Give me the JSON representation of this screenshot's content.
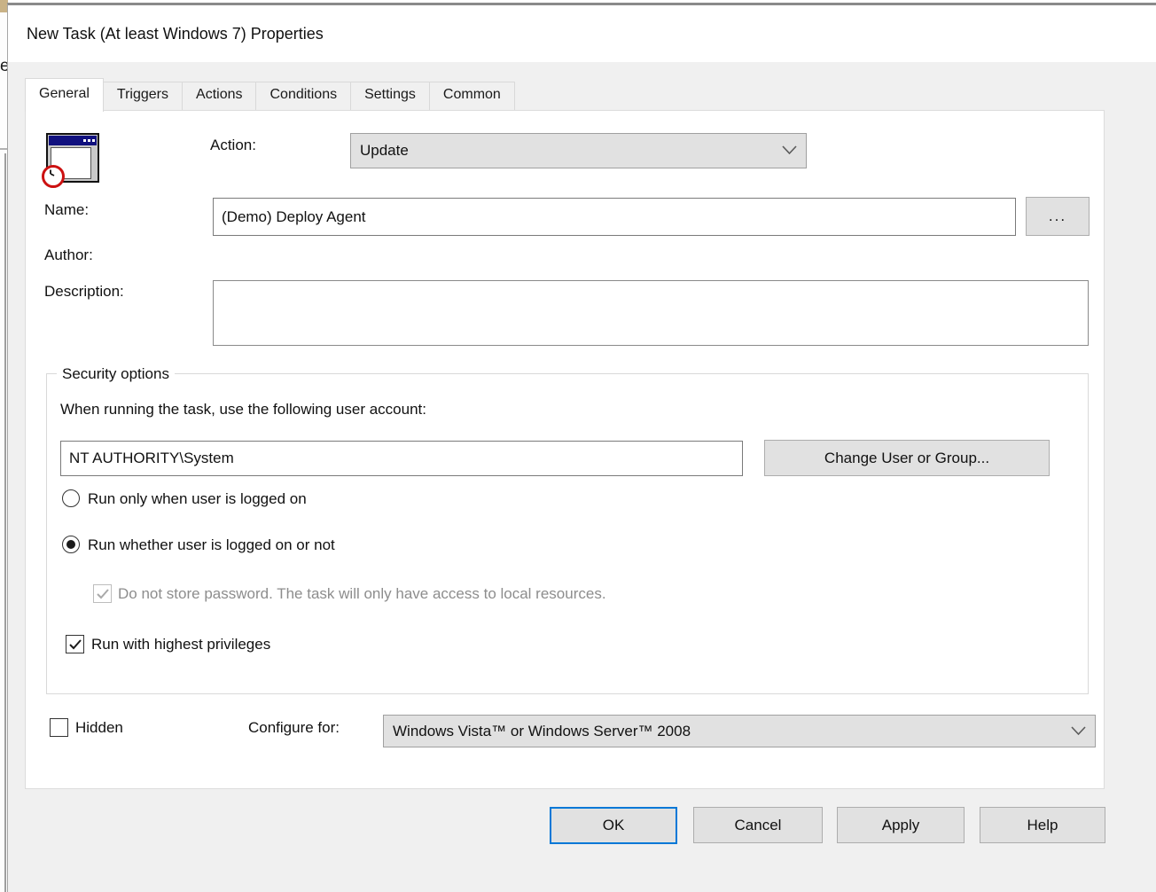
{
  "background": {
    "fragment_text": "e"
  },
  "window": {
    "title": "New Task (At least Windows 7) Properties"
  },
  "tabs": {
    "items": [
      "General",
      "Triggers",
      "Actions",
      "Conditions",
      "Settings",
      "Common"
    ],
    "active": "General"
  },
  "general": {
    "action_label": "Action:",
    "action_value": "Update",
    "name_label": "Name:",
    "name_value": "(Demo) Deploy Agent",
    "browse_label": "...",
    "author_label": "Author:",
    "description_label": "Description:",
    "security": {
      "legend": "Security options",
      "account_prompt": "When running the task, use the following user account:",
      "account_value": "NT AUTHORITY\\System",
      "change_user_label": "Change User or Group...",
      "radio_logged_on_label": "Run only when user is logged on",
      "radio_whether_label": "Run whether user is logged on or not",
      "no_password_label": "Do not store password. The task will only have access to local resources.",
      "privileges_label": "Run with highest privileges"
    },
    "hidden_label": "Hidden",
    "configure_label": "Configure for:",
    "configure_value": "Windows Vista™ or Windows Server™ 2008"
  },
  "state": {
    "run_only_when_logged_on": false,
    "run_whether_logged_on": true,
    "do_not_store_password_checked": true,
    "do_not_store_password_disabled": true,
    "run_with_highest_privileges": true,
    "hidden": false
  },
  "footer": {
    "ok_label": "OK",
    "cancel_label": "Cancel",
    "apply_label": "Apply",
    "help_label": "Help"
  },
  "colors": {
    "accent": "#0078d7",
    "dialog_bg": "#f0f0f0",
    "control_bg": "#e1e1e1",
    "control_border": "#adadad",
    "input_border": "#7a7a7a",
    "disabled_text": "#8d8d8d",
    "icon_titlebar_navy": "#10107e",
    "icon_clock_red": "#cc1111"
  }
}
